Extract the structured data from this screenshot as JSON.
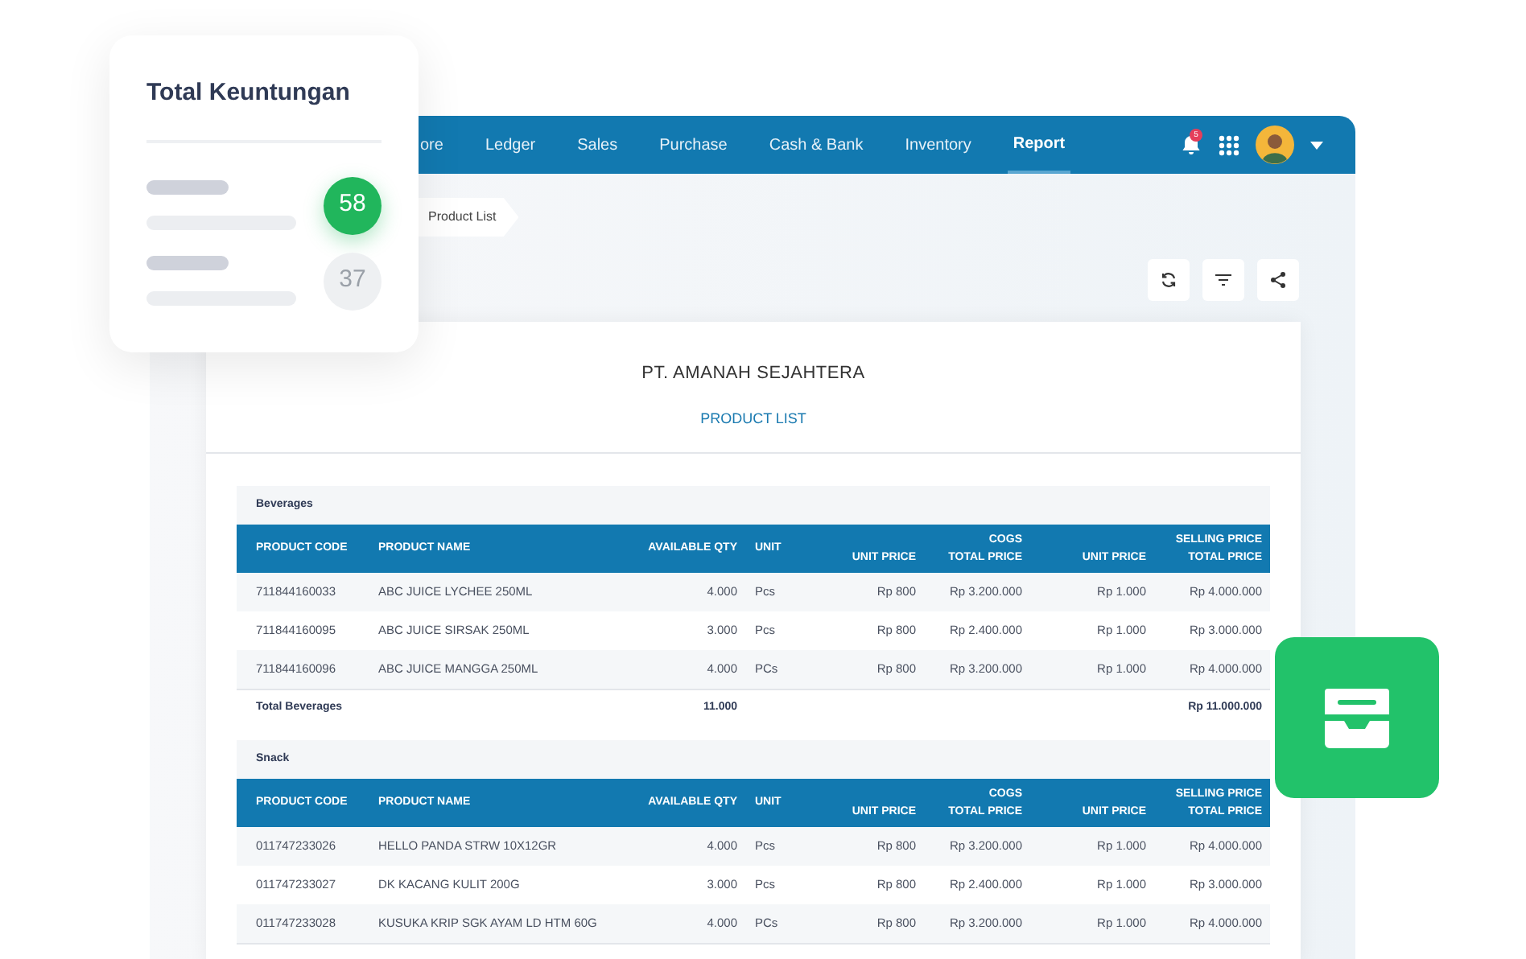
{
  "summary_card": {
    "title": "Total Keuntungan",
    "badges": [
      {
        "value": "58",
        "selected": true
      },
      {
        "value": "37",
        "selected": false
      }
    ]
  },
  "nav": {
    "items": [
      {
        "label": "ore",
        "selected": false
      },
      {
        "label": "Ledger",
        "selected": false
      },
      {
        "label": "Sales",
        "selected": false
      },
      {
        "label": "Purchase",
        "selected": false
      },
      {
        "label": "Cash & Bank",
        "selected": false
      },
      {
        "label": "Inventory",
        "selected": false
      },
      {
        "label": "Report",
        "selected": true
      }
    ],
    "notification_count": "5"
  },
  "breadcrumb": [
    "Product List"
  ],
  "report": {
    "company": "PT. AMANAH SEJAHTERA",
    "title": "PRODUCT LIST",
    "groups": [
      {
        "name": "Beverages",
        "column_groups": [
          "COGS",
          "SELLING PRICE"
        ],
        "columns": [
          "PRODUCT CODE",
          "PRODUCT NAME",
          "AVAILABLE QTY",
          "UNIT",
          "UNIT PRICE",
          "TOTAL PRICE",
          "UNIT PRICE",
          "TOTAL PRICE"
        ],
        "rows": [
          [
            "711844160033",
            "ABC JUICE  LYCHEE 250ML",
            "4.000",
            "Pcs",
            "Rp 800",
            "Rp 3.200.000",
            "Rp 1.000",
            "Rp 4.000.000"
          ],
          [
            "711844160095",
            "ABC JUICE SIRSAK 250ML",
            "3.000",
            "Pcs",
            "Rp 800",
            "Rp 2.400.000",
            "Rp 1.000",
            "Rp 3.000.000"
          ],
          [
            "711844160096",
            "ABC JUICE MANGGA 250ML",
            "4.000",
            "PCs",
            "Rp 800",
            "Rp 3.200.000",
            "Rp 1.000",
            "Rp 4.000.000"
          ]
        ],
        "total": {
          "label": "Total Beverages",
          "qty": "11.000",
          "selling_total": "Rp 11.000.000"
        }
      },
      {
        "name": "Snack",
        "column_groups": [
          "COGS",
          "SELLING PRICE"
        ],
        "columns": [
          "PRODUCT CODE",
          "PRODUCT NAME",
          "AVAILABLE QTY",
          "UNIT",
          "UNIT PRICE",
          "TOTAL PRICE",
          "UNIT PRICE",
          "TOTAL PRICE"
        ],
        "rows": [
          [
            "011747233026",
            "HELLO PANDA STRW 10X12GR",
            "4.000",
            "Pcs",
            "Rp 800",
            "Rp 3.200.000",
            "Rp 1.000",
            "Rp 4.000.000"
          ],
          [
            "011747233027",
            "DK KACANG KULIT 200G",
            "3.000",
            "Pcs",
            "Rp 800",
            "Rp 2.400.000",
            "Rp 1.000",
            "Rp 3.000.000"
          ],
          [
            "011747233028",
            "KUSUKA KRIP SGK AYAM LD HTM 60G",
            "4.000",
            "PCs",
            "Rp 800",
            "Rp 3.200.000",
            "Rp 1.000",
            "Rp 4.000.000"
          ]
        ]
      }
    ]
  }
}
